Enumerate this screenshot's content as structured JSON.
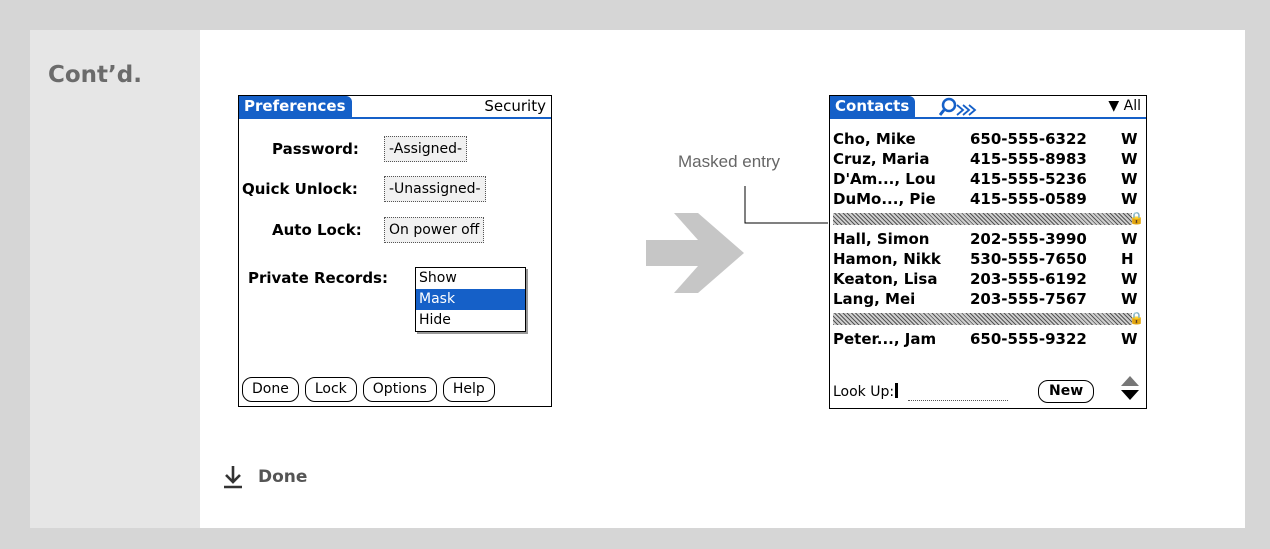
{
  "section_label": "Cont’d.",
  "preferences": {
    "title": "Preferences",
    "category": "Security",
    "password_label": "Password:",
    "password_value": "-Assigned-",
    "quick_unlock_label": "Quick Unlock:",
    "quick_unlock_value": "-Unassigned-",
    "auto_lock_label": "Auto Lock:",
    "auto_lock_value": "On power off",
    "private_records_label": "Private Records:",
    "private_options": [
      "Show",
      "Mask",
      "Hide"
    ],
    "buttons": [
      "Done",
      "Lock",
      "Options",
      "Help"
    ]
  },
  "contacts": {
    "title": "Contacts",
    "category": "All",
    "rows": [
      {
        "name": "Cho, Mike",
        "phone": "650-555-6322",
        "type": "W"
      },
      {
        "name": "Cruz, Maria",
        "phone": "415-555-8983",
        "type": "W"
      },
      {
        "name": "D'Am..., Lou",
        "phone": "415-555-5236",
        "type": "W"
      },
      {
        "name": "DuMo..., Pie",
        "phone": "415-555-0589",
        "type": "W"
      },
      {
        "name": "Hall, Simon",
        "phone": "202-555-3990",
        "type": "W"
      },
      {
        "name": "Hamon, Nikk",
        "phone": "530-555-7650",
        "type": "H"
      },
      {
        "name": "Keaton, Lisa",
        "phone": "203-555-6192",
        "type": "W"
      },
      {
        "name": "Lang, Mei",
        "phone": "203-555-7567",
        "type": "W"
      },
      {
        "name": "Peter..., Jam",
        "phone": "650-555-9322",
        "type": "W"
      }
    ],
    "lookup_label": "Look Up:",
    "new_button": "New"
  },
  "annotation": {
    "masked_entry": "Masked entry"
  },
  "done_label": "Done",
  "colors": {
    "palm_blue": "#1560c8",
    "arrow_gray": "#c6c6c6",
    "label_gray": "#666666"
  }
}
